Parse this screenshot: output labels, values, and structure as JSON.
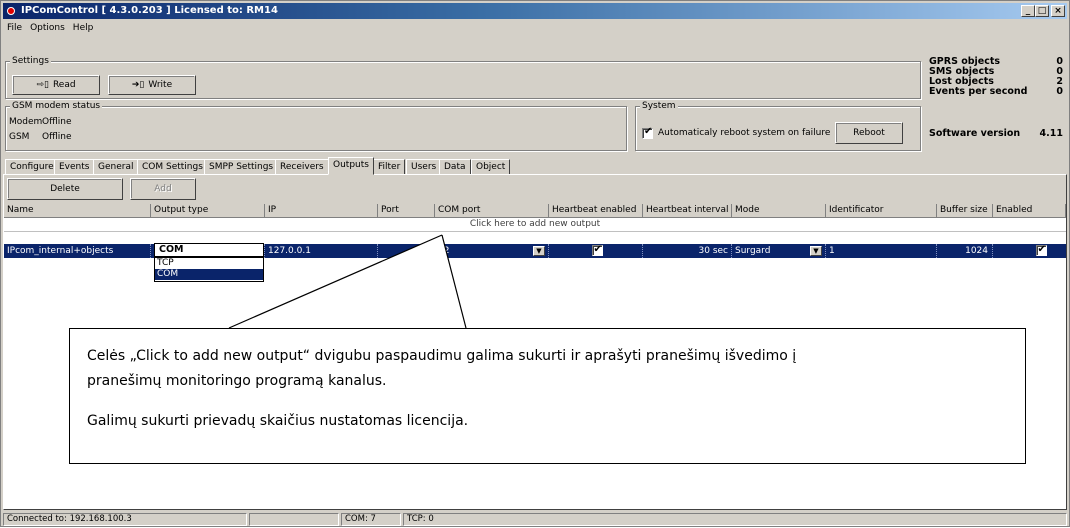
{
  "window": {
    "title": "IPComControl [ 4.3.0.203 ]  Licensed to: RM14",
    "min_label": "_",
    "max_label": "□",
    "close_label": "×"
  },
  "menu": [
    "File",
    "Options",
    "Help"
  ],
  "settings": {
    "group_label": "Settings",
    "read_label": "Read",
    "write_label": "Write"
  },
  "gsm": {
    "group_label": "GSM modem status",
    "modem_label": "Modem",
    "modem_value": "Offline",
    "gsm_label": "GSM",
    "gsm_value": "Offline"
  },
  "system": {
    "group_label": "System",
    "auto_reboot_label": "Automaticaly reboot system on failure",
    "auto_reboot_checked": true,
    "reboot_label": "Reboot"
  },
  "stats": [
    {
      "label": "GPRS objects",
      "value": "0"
    },
    {
      "label": "SMS objects",
      "value": "0"
    },
    {
      "label": "Lost objects",
      "value": "2"
    },
    {
      "label": "Events per second",
      "value": "0"
    }
  ],
  "software": {
    "label": "Software version",
    "value": "4.11"
  },
  "tabs": [
    "Configure",
    "Events",
    "General",
    "COM Settings",
    "SMPP Settings",
    "Receivers",
    "Outputs",
    "Filter",
    "Users",
    "Data",
    "Object"
  ],
  "active_tab": "Outputs",
  "toolbar": {
    "delete_label": "Delete",
    "add_label": "Add"
  },
  "table": {
    "columns": [
      "Name",
      "Output type",
      "IP",
      "Port",
      "COM port",
      "Heartbeat enabled",
      "Heartbeat interval",
      "Mode",
      "Identificator",
      "Buffer size",
      "Enabled"
    ],
    "add_row_text": "Click here to add new output",
    "row": {
      "name": "IPcom_internal+objects",
      "output_type": "COM",
      "ip": "127.0.0.1",
      "port": "",
      "com_port": "12",
      "heartbeat_enabled": true,
      "heartbeat_interval": "30 sec",
      "mode": "Surgard",
      "identificator": "1",
      "buffer_size": "1024",
      "enabled": true
    },
    "dropdown_options": [
      "TCP",
      "COM"
    ],
    "dropdown_selected": "COM"
  },
  "callout": {
    "line1": "Celės „Click to add new output“ dvigubu paspaudimu galima sukurti ir aprašyti pranešimų išvedimo į",
    "line2": "pranešimų monitoringo programą kanalus.",
    "line3": "Galimų sukurti prievadų skaičius nustatomas licencija."
  },
  "status": {
    "connected": "Connected to: 192.168.100.3",
    "blank": "",
    "com": "COM: 7",
    "tcp": "TCP: 0"
  }
}
